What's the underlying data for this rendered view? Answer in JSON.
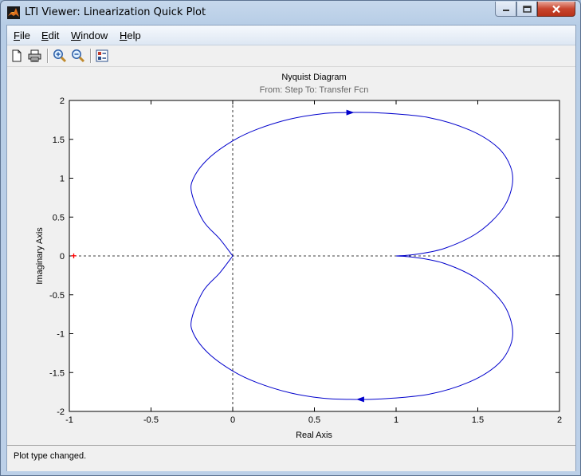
{
  "window": {
    "title": "LTI Viewer: Linearization Quick Plot"
  },
  "menu": [
    {
      "label": "File",
      "mnemonic": "F",
      "rest": "ile"
    },
    {
      "label": "Edit",
      "mnemonic": "E",
      "rest": "dit"
    },
    {
      "label": "Window",
      "mnemonic": "W",
      "rest": "indow"
    },
    {
      "label": "Help",
      "mnemonic": "H",
      "rest": "elp"
    }
  ],
  "toolbar": {
    "icons": [
      "new-file-icon",
      "print-icon",
      "zoom-in-icon",
      "zoom-out-icon",
      "plot-config-icon"
    ]
  },
  "status": {
    "text": "Plot type changed."
  },
  "colors": {
    "curve": "#0000cc",
    "critical_point": "#ff0000",
    "grid": "#000000"
  },
  "chart_data": {
    "type": "line",
    "title": "Nyquist Diagram",
    "subtitle": "From: Step  To: Transfer Fcn",
    "xlabel": "Real Axis",
    "ylabel": "Imaginary Axis",
    "xlim": [
      -1,
      2
    ],
    "ylim": [
      -2,
      2
    ],
    "xticks": [
      "-1",
      "-0.5",
      "0",
      "0.5",
      "1",
      "1.5",
      "2"
    ],
    "yticks": [
      "2",
      "1.5",
      "1",
      "0.5",
      "0",
      "-0.5",
      "-1",
      "-1.5",
      "-2"
    ],
    "critical_point": [
      -1,
      0
    ],
    "series": [
      {
        "x": [
          1.0,
          1.12,
          1.3,
          1.5,
          1.65,
          1.71,
          1.7,
          1.62,
          1.45,
          1.2,
          0.9,
          0.72,
          0.55,
          0.35,
          0.15,
          0.0,
          -0.15,
          -0.24,
          -0.25,
          -0.18,
          -0.08,
          0.0
        ],
        "y": [
          0.0,
          0.02,
          0.1,
          0.3,
          0.6,
          0.9,
          1.15,
          1.4,
          1.62,
          1.78,
          1.84,
          1.845,
          1.83,
          1.76,
          1.63,
          1.48,
          1.25,
          1.0,
          0.8,
          0.45,
          0.22,
          0.0
        ]
      },
      {
        "x": [
          1.0,
          1.12,
          1.3,
          1.5,
          1.65,
          1.71,
          1.7,
          1.62,
          1.45,
          1.2,
          0.9,
          0.72,
          0.55,
          0.35,
          0.15,
          0.0,
          -0.15,
          -0.24,
          -0.25,
          -0.18,
          -0.08,
          0.0
        ],
        "y": [
          0.0,
          -0.02,
          -0.1,
          -0.3,
          -0.6,
          -0.9,
          -1.15,
          -1.4,
          -1.62,
          -1.78,
          -1.84,
          -1.845,
          -1.83,
          -1.76,
          -1.63,
          -1.48,
          -1.25,
          -1.0,
          -0.8,
          -0.45,
          -0.22,
          0.0
        ]
      }
    ],
    "arrows": [
      {
        "x": 0.72,
        "y": 1.845,
        "direction": "right"
      },
      {
        "x": 0.78,
        "y": -1.845,
        "direction": "left"
      }
    ],
    "grid": false,
    "zero_lines": true
  }
}
